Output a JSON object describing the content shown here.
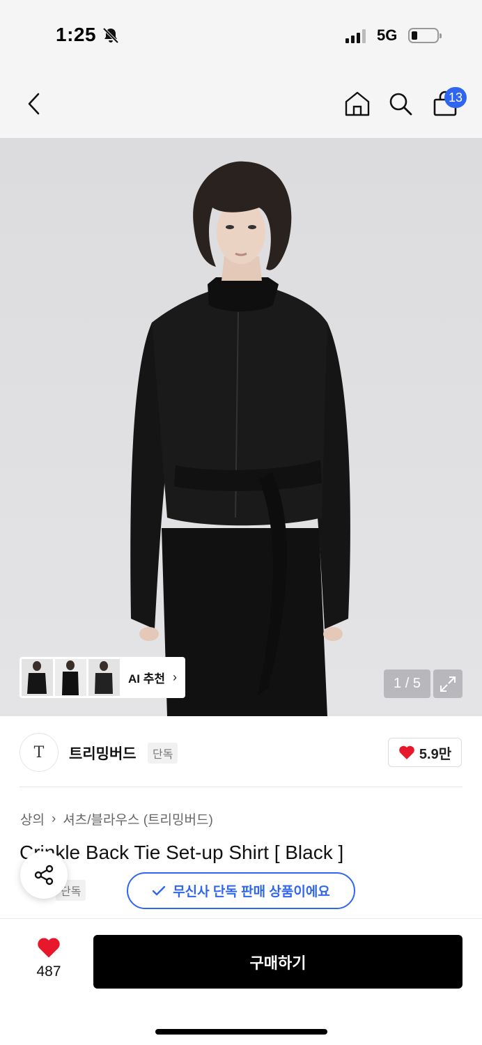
{
  "status_bar": {
    "time": "1:25",
    "network": "5G",
    "battery_icon": "battery-low-icon"
  },
  "nav": {
    "cart_count": "13",
    "icons": [
      "back-chevron-icon",
      "home-icon",
      "search-icon",
      "shopping-bag-icon"
    ]
  },
  "gallery": {
    "ai_recommend_label": "AI 추천",
    "ai_recommend_chevron": "›",
    "page_indicator": "1 / 5"
  },
  "brand": {
    "logo_text": "T",
    "name": "트리밍버드",
    "tag": "단독",
    "likes": "5.9만"
  },
  "product": {
    "breadcrumb": [
      "상의",
      "셔츠/블라우스 (트리밍버드)"
    ],
    "breadcrumb_separator": "›",
    "title": "Crinkle Back Tie Set-up Shirt [ Black ]",
    "tag": "단독",
    "exclusive_notice": "무신사 단독 판매 상품이에요"
  },
  "bottom_bar": {
    "wish_count": "487",
    "buy_label": "구매하기"
  },
  "colors": {
    "accent": "#2f66f0",
    "heart": "#e8182c",
    "buy_bg": "#000000"
  }
}
